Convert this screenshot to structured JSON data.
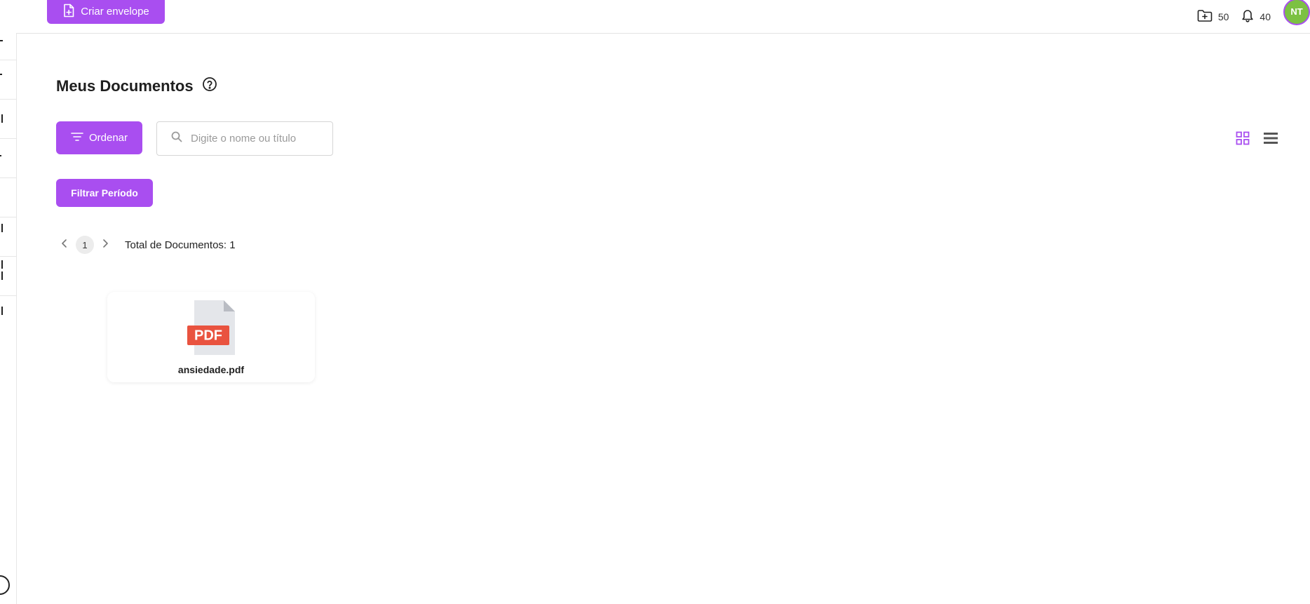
{
  "header": {
    "create_label": "Criar envelope",
    "folder_count": "50",
    "notification_count": "40",
    "avatar_initials": "NT"
  },
  "page": {
    "title": "Meus Documentos"
  },
  "toolbar": {
    "order_label": "Ordenar",
    "search_placeholder": "Digite o nome ou título",
    "search_value": "",
    "filter_label": "Filtrar Período"
  },
  "pagination": {
    "current_page": "1",
    "total_label": "Total de Documentos: 1"
  },
  "documents": [
    {
      "name": "ansiedade.pdf",
      "file_badge": "PDF"
    }
  ],
  "colors": {
    "accent": "#a94ef0",
    "pdf_red": "#e9533f",
    "avatar_green": "#7cc143"
  },
  "icons": {
    "create": "file-plus-icon",
    "folder": "folder-plus-icon",
    "bell": "bell-icon",
    "help": "help-circle-icon",
    "order": "filter-lines-icon",
    "search": "search-icon",
    "grid": "grid-view-icon",
    "list": "list-view-icon",
    "prev": "chevron-left-icon",
    "next": "chevron-right-icon",
    "pdf": "pdf-file-icon"
  }
}
